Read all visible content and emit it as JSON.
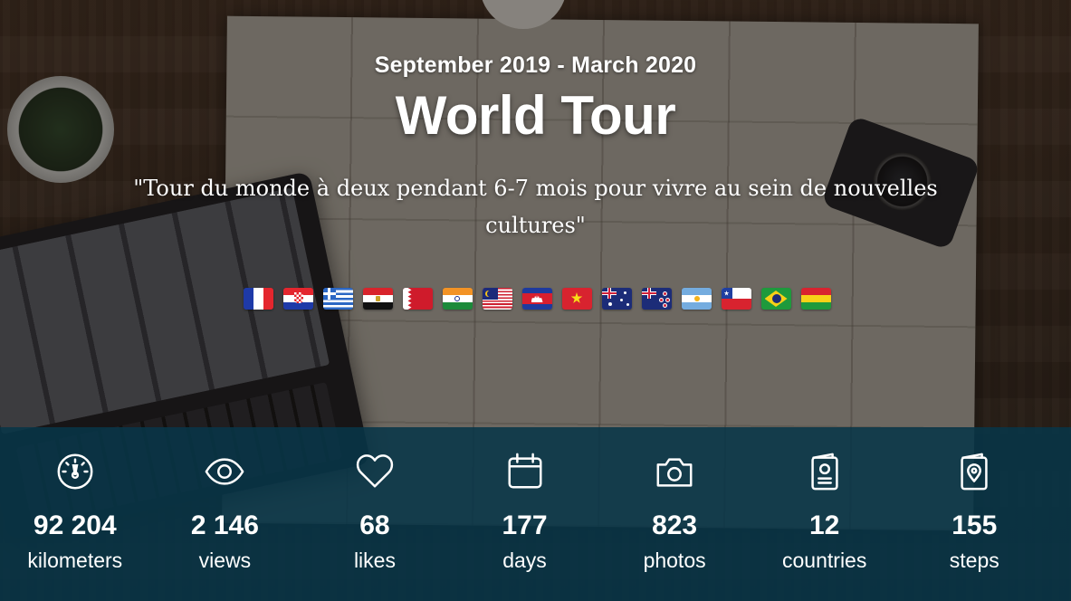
{
  "trip": {
    "dates": "September 2019 - March 2020",
    "title": "World Tour",
    "quote": "\"Tour du monde à deux pendant 6-7 mois pour vivre au sein de nouvelles cultures\""
  },
  "flags": [
    {
      "icon": "france-flag-icon"
    },
    {
      "icon": "croatia-flag-icon"
    },
    {
      "icon": "greece-flag-icon"
    },
    {
      "icon": "egypt-flag-icon"
    },
    {
      "icon": "bahrain-flag-icon"
    },
    {
      "icon": "india-flag-icon"
    },
    {
      "icon": "malaysia-flag-icon"
    },
    {
      "icon": "cambodia-flag-icon"
    },
    {
      "icon": "vietnam-flag-icon"
    },
    {
      "icon": "australia-flag-icon"
    },
    {
      "icon": "new-zealand-flag-icon"
    },
    {
      "icon": "argentina-flag-icon"
    },
    {
      "icon": "chile-flag-icon"
    },
    {
      "icon": "brazil-flag-icon"
    },
    {
      "icon": "bolivia-flag-icon"
    }
  ],
  "stats": [
    {
      "icon": "speedometer-icon",
      "value": "92 204",
      "label": "kilometers"
    },
    {
      "icon": "eye-icon",
      "value": "2 146",
      "label": "views"
    },
    {
      "icon": "heart-icon",
      "value": "68",
      "label": "likes"
    },
    {
      "icon": "calendar-icon",
      "value": "177",
      "label": "days"
    },
    {
      "icon": "camera-icon",
      "value": "823",
      "label": "photos"
    },
    {
      "icon": "passport-icon",
      "value": "12",
      "label": "countries"
    },
    {
      "icon": "map-pin-card-icon",
      "value": "155",
      "label": "steps"
    }
  ],
  "colors": {
    "stats_bar": "#083648",
    "text": "#ffffff"
  }
}
